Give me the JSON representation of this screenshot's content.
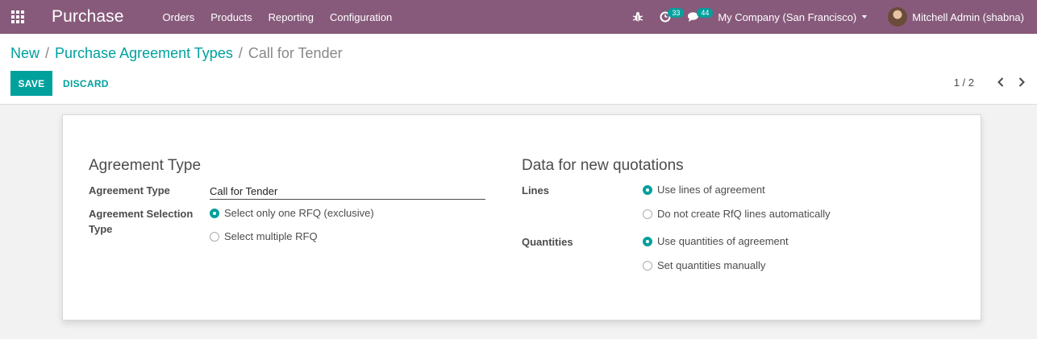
{
  "navbar": {
    "brand": "Purchase",
    "menu": [
      "Orders",
      "Products",
      "Reporting",
      "Configuration"
    ],
    "activity_count": "33",
    "message_count": "44",
    "company": "My Company (San Francisco)",
    "user": "Mitchell Admin (shabna)",
    "bg_color": "#875a7b"
  },
  "breadcrumb": {
    "items": [
      "New",
      "Purchase Agreement Types"
    ],
    "current": "Call for Tender"
  },
  "buttons": {
    "save": "SAVE",
    "discard": "DISCARD"
  },
  "pager": {
    "value": "1 / 2"
  },
  "form": {
    "left_title": "Agreement Type",
    "agreement_type_label": "Agreement Type",
    "agreement_type_value": "Call for Tender",
    "selection_type_label_1": "Agreement Selection",
    "selection_type_label_2": "Type",
    "selection_options": [
      "Select only one RFQ (exclusive)",
      "Select multiple RFQ"
    ],
    "right_title": "Data for new quotations",
    "lines_label": "Lines",
    "lines_options": [
      "Use lines of agreement",
      "Do not create RfQ lines automatically"
    ],
    "quantities_label": "Quantities",
    "quantities_options": [
      "Use quantities of agreement",
      "Set quantities manually"
    ]
  },
  "accent_color": "#00a09d"
}
